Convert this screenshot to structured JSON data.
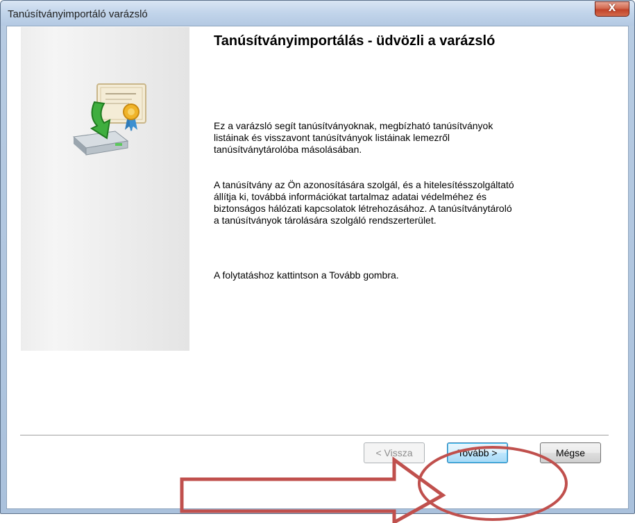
{
  "window": {
    "title": "Tanúsítványimportáló varázsló",
    "close_glyph": "X"
  },
  "wizard": {
    "icon": "certificate-import-icon",
    "heading": "Tanúsítványimportálás - üdvözli a varázsló",
    "paragraph_1": "Ez a varázsló segít tanúsítványoknak, megbízható tanúsítványok\nlistáinak és visszavont tanúsítványok listáinak lemezről\ntanúsítványtárolóba másolásában.",
    "paragraph_2": "A tanúsítvány az Ön azonosítására szolgál, és a hitelesítésszolgáltató\nállítja ki, továbbá információkat tartalmaz adatai védelméhez és\nbiztonságos hálózati kapcsolatok létrehozásához. A tanúsítványtároló\na tanúsítványok tárolására szolgáló rendszerterület.",
    "paragraph_3": "A folytatáshoz kattintson a Tovább gombra."
  },
  "buttons": {
    "back_label": "< Vissza",
    "next_label": "Tovább >",
    "cancel_label": "Mégse"
  },
  "annotation": {
    "color": "#c0504d"
  }
}
